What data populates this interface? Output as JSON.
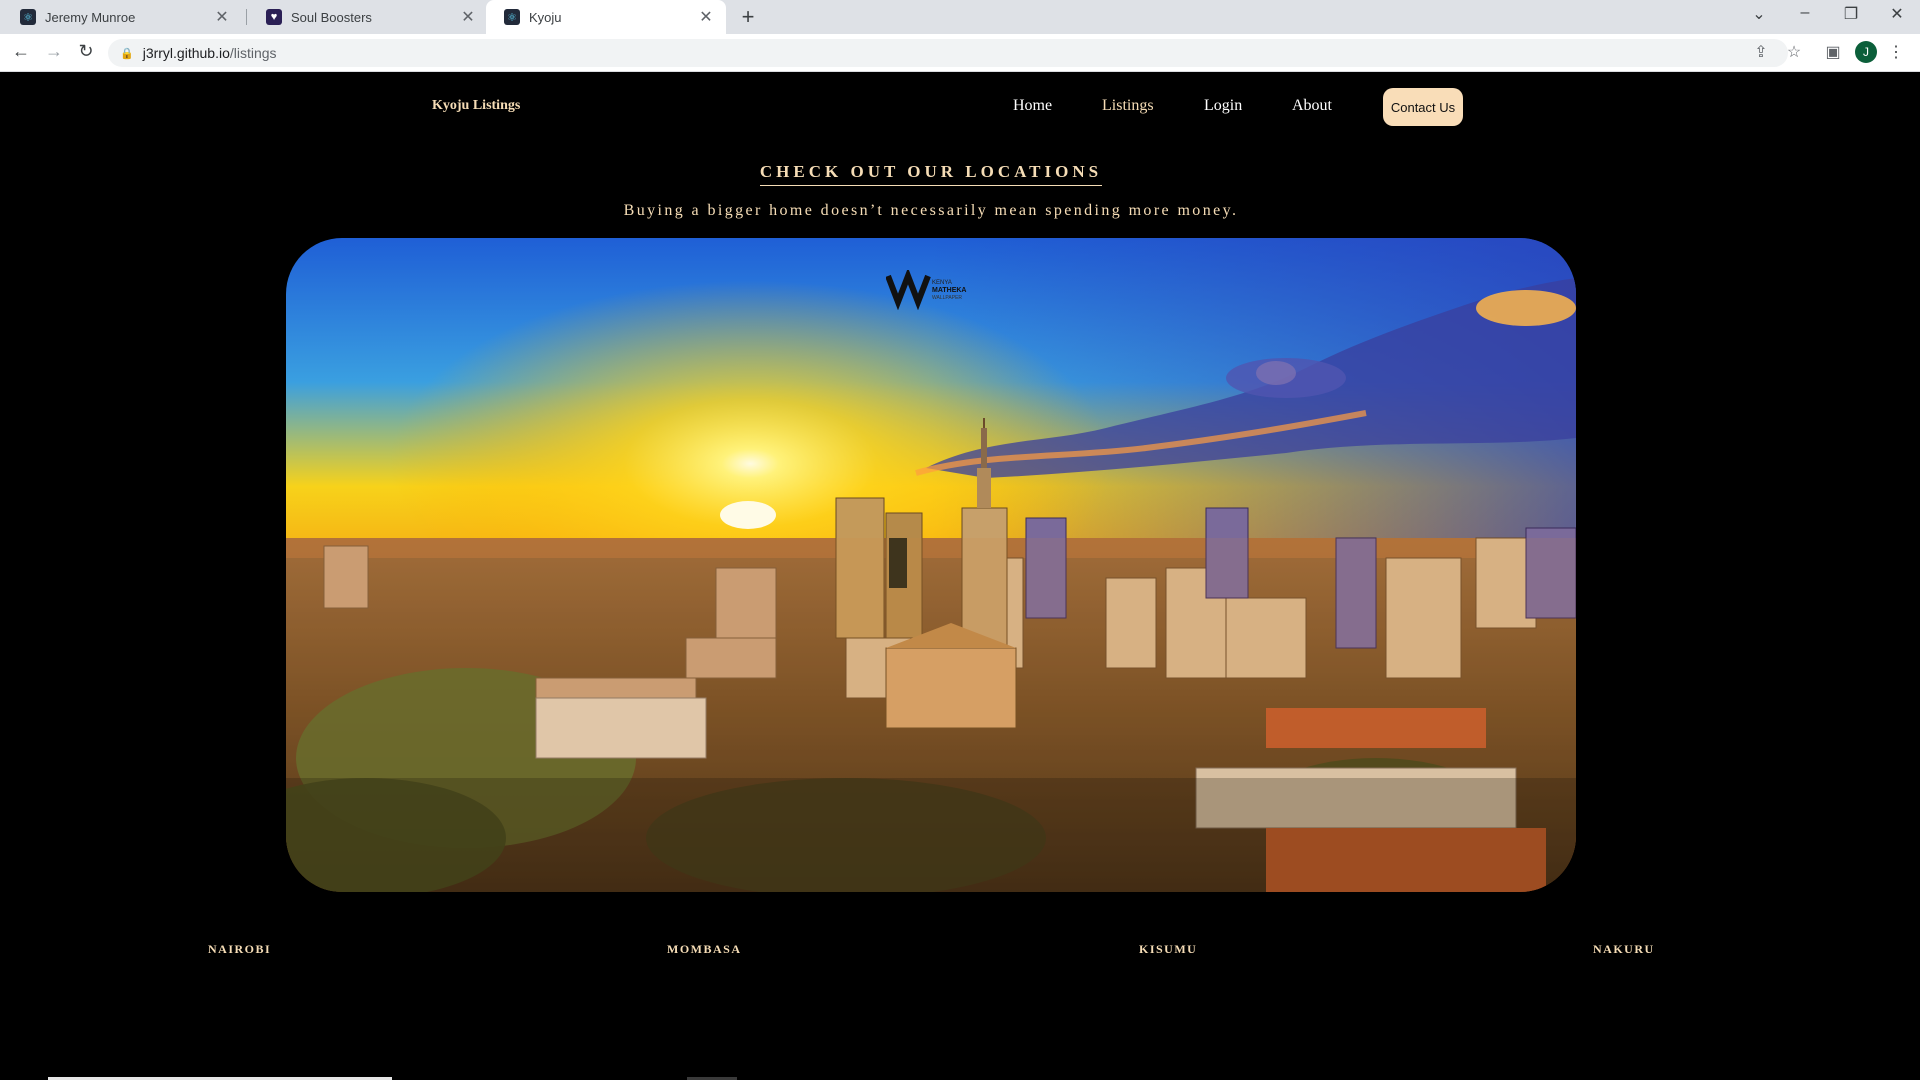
{
  "browser": {
    "tabs": [
      {
        "title": "Jeremy Munroe",
        "icon": "react-icon",
        "active": false
      },
      {
        "title": "Soul Boosters",
        "icon": "soul-icon",
        "active": false
      },
      {
        "title": "Kyoju",
        "icon": "react-icon",
        "active": true
      }
    ],
    "url_host": "j3rryl.github.io",
    "url_path": "/listings",
    "profile_initial": "J"
  },
  "site": {
    "brand": "Kyoju Listings",
    "nav": [
      "Home",
      "Listings",
      "Login",
      "About"
    ],
    "contact_label": "Contact Us",
    "heading": "CHECK OUT OUR LOCATIONS",
    "subheading": "Buying a bigger home doesn’t necessarily mean spending more money.",
    "watermark_lines": [
      "KENYA",
      "MATHEKA",
      "WALLPAPER"
    ],
    "cities": [
      "NAIROBI",
      "MOMBASA",
      "KISUMU",
      "NAKURU"
    ]
  },
  "colors": {
    "accent_text": "#f6ddb6",
    "contact_button": "#f9ddb8",
    "background": "#000000"
  }
}
